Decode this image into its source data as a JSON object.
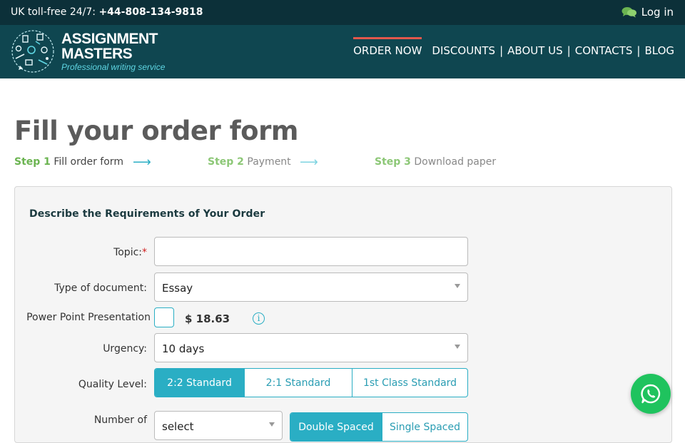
{
  "topbar": {
    "phone_prefix": "UK toll-free 24/7: ",
    "phone_number": "+44-808-134-9818",
    "login_label": "Log in"
  },
  "logo": {
    "line1": "ASSIGNMENT",
    "line2": "MASTERS",
    "tagline": "Professional writing service"
  },
  "nav": {
    "items": [
      "ORDER NOW",
      "DISCOUNTS",
      "ABOUT US",
      "CONTACTS",
      "BLOG"
    ],
    "separator": "|"
  },
  "page": {
    "title": "Fill your order form"
  },
  "steps": [
    {
      "num": "Step 1",
      "label": "Fill order form"
    },
    {
      "num": "Step 2",
      "label": "Payment"
    },
    {
      "num": "Step 3",
      "label": "Download paper"
    }
  ],
  "arrow": "⟶",
  "form": {
    "heading": "Describe the Requirements of Your Order",
    "topic": {
      "label": "Topic:",
      "required_mark": "*",
      "value": ""
    },
    "doc_type": {
      "label": "Type of document:",
      "value": "Essay"
    },
    "ppt": {
      "label": "Power Point Presentation",
      "price": "$ 18.63",
      "info": "i"
    },
    "urgency": {
      "label": "Urgency:",
      "value": "10 days"
    },
    "quality": {
      "label": "Quality Level:",
      "options": [
        "2:2 Standard",
        "2:1 Standard",
        "1st Class Standard"
      ],
      "selected": 0
    },
    "pages": {
      "label": "Number of",
      "value": "select"
    },
    "spacing": {
      "options": [
        "Double Spaced",
        "Single Spaced"
      ],
      "selected": 0
    }
  },
  "colors": {
    "topbar": "#0c3039",
    "header": "#0f4650",
    "accent": "#2aaec4",
    "step_green": "#6bb451",
    "nav_active": "#e2574c",
    "whatsapp": "#1fc35e"
  },
  "icons": {
    "login": "chat-bubbles-icon",
    "logo": "doodle-circle-icon",
    "info": "info-icon",
    "whatsapp": "whatsapp-icon"
  }
}
